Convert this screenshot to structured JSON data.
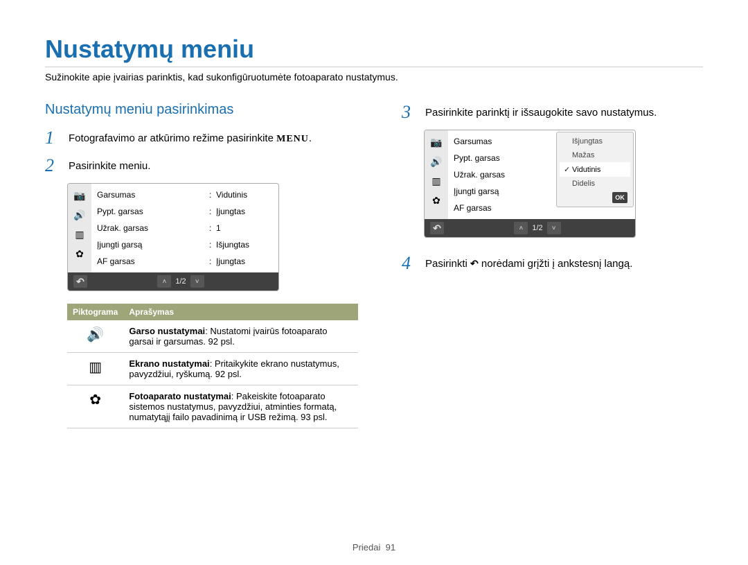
{
  "title": "Nustatymų meniu",
  "intro": "Sužinokite apie įvairias parinktis, kad sukonfigūruotumėte fotoaparato nustatymus.",
  "section_head": "Nustatymų meniu pasirinkimas",
  "steps": {
    "s1_pre": "Fotografavimo ar atkūrimo režime pasirinkite ",
    "s1_menu": "MENU",
    "s1_post": ".",
    "s2": "Pasirinkite meniu.",
    "s3": "Pasirinkite parinktį ir išsaugokite savo nustatymus.",
    "s4_pre": "Pasirinkti ",
    "s4_post": " norėdami grįžti į ankstesnį langą."
  },
  "step_nums": {
    "n1": "1",
    "n2": "2",
    "n3": "3",
    "n4": "4"
  },
  "screen1": {
    "rows": [
      {
        "label": "Garsumas",
        "value": "Vidutinis"
      },
      {
        "label": "Pypt. garsas",
        "value": "Įjungtas"
      },
      {
        "label": "Užrak. garsas",
        "value": "1"
      },
      {
        "label": "Įjungti garsą",
        "value": "Išjungtas"
      },
      {
        "label": "AF garsas",
        "value": "Įjungtas"
      }
    ],
    "page": "1/2"
  },
  "screen2": {
    "rows": [
      {
        "label": "Garsumas"
      },
      {
        "label": "Pypt. garsas"
      },
      {
        "label": "Užrak. garsas"
      },
      {
        "label": "Įjungti garsą"
      },
      {
        "label": "AF garsas"
      }
    ],
    "options": [
      {
        "label": "Išjungtas",
        "selected": false
      },
      {
        "label": "Mažas",
        "selected": false
      },
      {
        "label": "Vidutinis",
        "selected": true
      },
      {
        "label": "Didelis",
        "selected": false
      }
    ],
    "ok": "OK",
    "page": "1/2"
  },
  "legend": {
    "head_icon": "Piktograma",
    "head_desc": "Aprašymas",
    "rows": [
      {
        "icon": "sound",
        "title": "Garso nustatymai",
        "body": ": Nustatomi įvairūs fotoaparato garsai ir garsumas. 92 psl."
      },
      {
        "icon": "display",
        "title": "Ekrano nustatymai",
        "body": ": Pritaikykite ekrano nustatymus, pavyzdžiui, ryškumą. 92 psl."
      },
      {
        "icon": "gear",
        "title": "Fotoaparato nustatymai",
        "body": ": Pakeiskite fotoaparato sistemos nustatymus, pavyzdžiui, atminties formatą, numatytąjį failo pavadinimą ir USB režimą. 93 psl."
      }
    ]
  },
  "footer": {
    "section": "Priedai",
    "page": "91"
  }
}
